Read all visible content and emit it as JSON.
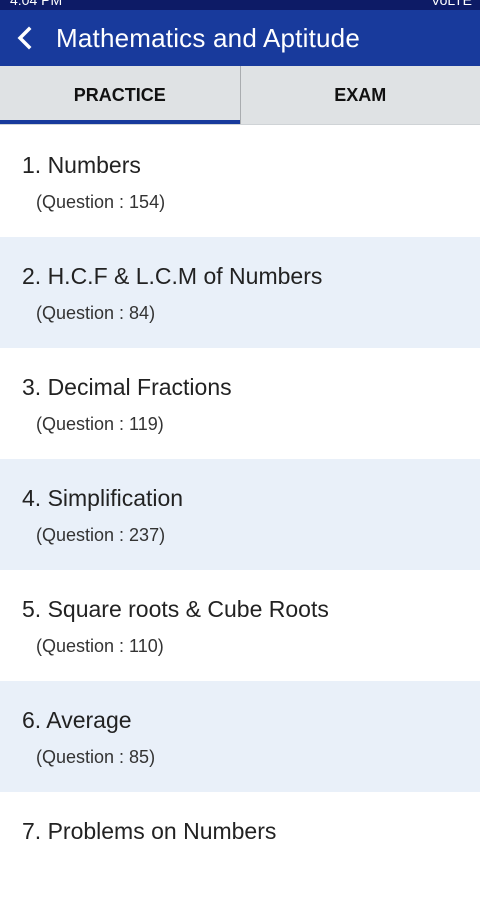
{
  "status": {
    "time": "4:04 PM",
    "indicators": "VoLTE"
  },
  "header": {
    "title": "Mathematics and Aptitude",
    "back_icon": "chevron-left-icon"
  },
  "tabs": [
    {
      "label": "PRACTICE",
      "active": true
    },
    {
      "label": "EXAM",
      "active": false
    }
  ],
  "topics": [
    {
      "title": "1.  Numbers",
      "count": "(Question : 154)"
    },
    {
      "title": "2.  H.C.F & L.C.M of Numbers",
      "count": "(Question : 84)"
    },
    {
      "title": "3.  Decimal Fractions",
      "count": "(Question : 119)"
    },
    {
      "title": "4.  Simplification",
      "count": "(Question : 237)"
    },
    {
      "title": "5.  Square roots & Cube Roots",
      "count": "(Question : 110)"
    },
    {
      "title": "6.  Average",
      "count": "(Question : 85)"
    },
    {
      "title": "7.  Problems on Numbers",
      "count": ""
    }
  ],
  "colors": {
    "app_bar": "#183a9c",
    "status_bar": "#0d1b66",
    "alt_row": "#e9f0f9",
    "tab_bg": "#dfe2e4"
  }
}
